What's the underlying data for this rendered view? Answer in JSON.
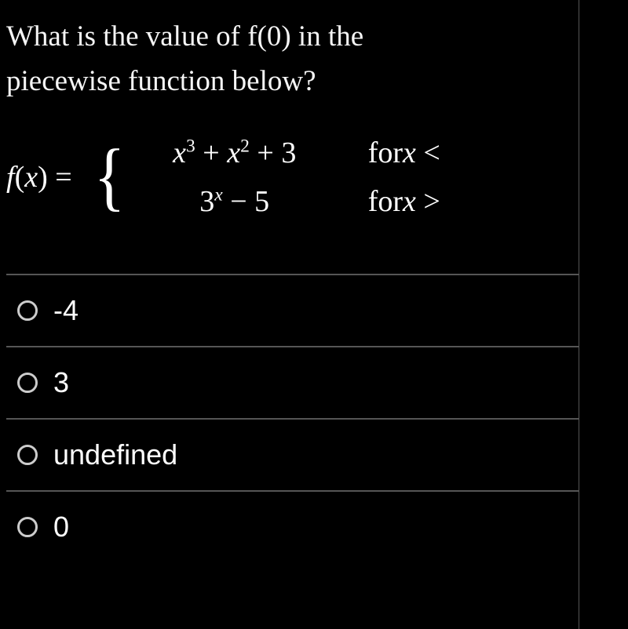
{
  "question": {
    "line1": "What is the value of f(0) in the",
    "line2": "piecewise function below?"
  },
  "math": {
    "lhs_f": "f",
    "lhs_paren_open": " (",
    "lhs_x": "x",
    "lhs_paren_close": ") = ",
    "case1_expr_parts": {
      "x1": "x",
      "sup1": "3",
      "plus1": " + ",
      "x2": "x",
      "sup2": "2",
      "plus2": " + 3"
    },
    "case2_expr_parts": {
      "base": "3",
      "exp": "x",
      "rest": " − 5"
    },
    "cond1_for": "for",
    "cond1_x": "x",
    "cond1_op": " <",
    "cond2_for": "for",
    "cond2_x": "x",
    "cond2_op": " >"
  },
  "options": [
    {
      "label": "-4"
    },
    {
      "label": "3"
    },
    {
      "label": "undefined"
    },
    {
      "label": "0"
    }
  ]
}
